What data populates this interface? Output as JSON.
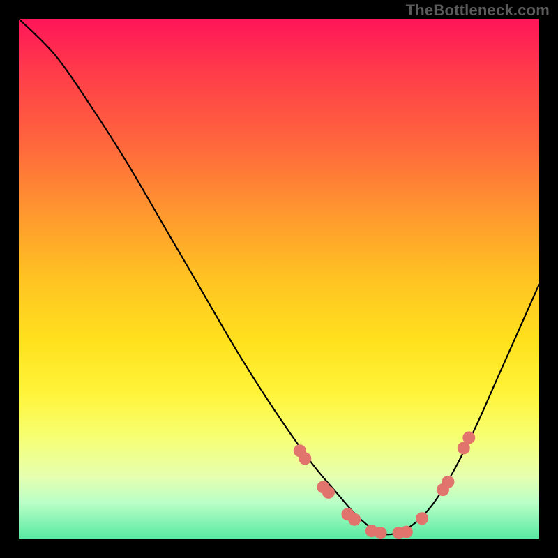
{
  "watermark": "TheBottleneck.com",
  "colors": {
    "frame_bg": "#000000",
    "curve": "#000000",
    "marker": "#e2746e",
    "gradient_stops": [
      "#ff1559",
      "#ff3b4a",
      "#ff6a3c",
      "#ff9a2e",
      "#ffc322",
      "#ffe11e",
      "#fff43a",
      "#f7ff70",
      "#e6ffb0",
      "#b9ffc6",
      "#57e9a2"
    ]
  },
  "chart_data": {
    "type": "line",
    "title": "",
    "xlabel": "",
    "ylabel": "",
    "xlim": [
      0,
      1
    ],
    "ylim": [
      0,
      1
    ],
    "series": [
      {
        "name": "bottleneck-curve",
        "x": [
          0.0,
          0.07,
          0.14,
          0.21,
          0.28,
          0.35,
          0.42,
          0.49,
          0.56,
          0.61,
          0.655,
          0.7,
          0.745,
          0.79,
          0.835,
          0.88,
          0.92,
          0.96,
          1.0
        ],
        "y": [
          1.0,
          0.93,
          0.83,
          0.72,
          0.6,
          0.48,
          0.36,
          0.25,
          0.15,
          0.09,
          0.04,
          0.01,
          0.02,
          0.06,
          0.13,
          0.22,
          0.31,
          0.4,
          0.49
        ]
      }
    ],
    "markers": {
      "name": "highlight-points",
      "x": [
        0.54,
        0.55,
        0.585,
        0.595,
        0.632,
        0.645,
        0.678,
        0.695,
        0.73,
        0.745,
        0.775,
        0.815,
        0.825,
        0.855,
        0.865
      ],
      "y": [
        0.17,
        0.155,
        0.1,
        0.09,
        0.048,
        0.038,
        0.016,
        0.012,
        0.012,
        0.014,
        0.04,
        0.095,
        0.11,
        0.175,
        0.195
      ]
    }
  }
}
